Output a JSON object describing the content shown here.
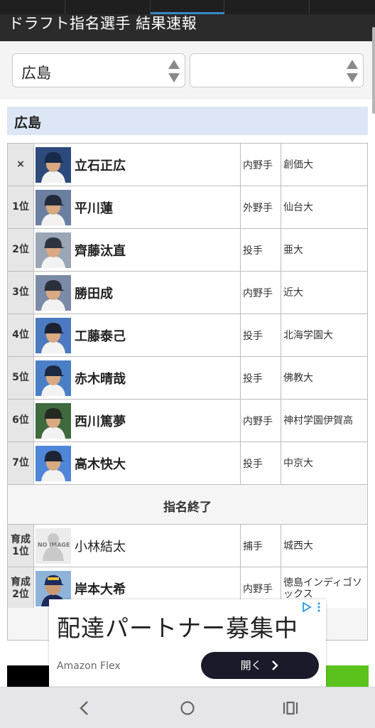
{
  "header": {
    "title": "ドラフト指名選手 結果速報"
  },
  "selects": {
    "team_value": "広島",
    "second_value": ""
  },
  "team_section": {
    "title": "広島"
  },
  "picks": [
    {
      "rank": "×",
      "name": "立石正広",
      "position": "内野手",
      "school": "創価大"
    },
    {
      "rank": "1位",
      "name": "平川蓮",
      "position": "外野手",
      "school": "仙台大"
    },
    {
      "rank": "2位",
      "name": "齊藤汰直",
      "position": "投手",
      "school": "亜大"
    },
    {
      "rank": "3位",
      "name": "勝田成",
      "position": "内野手",
      "school": "近大"
    },
    {
      "rank": "4位",
      "name": "工藤泰己",
      "position": "投手",
      "school": "北海学園大"
    },
    {
      "rank": "5位",
      "name": "赤木晴哉",
      "position": "投手",
      "school": "佛教大"
    },
    {
      "rank": "6位",
      "name": "西川篤夢",
      "position": "内野手",
      "school": "神村学園伊賀高"
    },
    {
      "rank": "7位",
      "name": "高木快大",
      "position": "投手",
      "school": "中京大"
    }
  ],
  "end_label": "指名終了",
  "development": [
    {
      "rank_line1": "育成",
      "rank_line2": "1位",
      "name": "小林結太",
      "position": "捕手",
      "school": "城西大",
      "noimage": "NO IMAGE"
    },
    {
      "rank_line1": "育成",
      "rank_line2": "2位",
      "name": "岸本大希",
      "position": "内野手",
      "school": "徳島インディゴソックス"
    }
  ],
  "ad": {
    "headline": "配達パートナー募集中",
    "brand": "Amazon Flex",
    "button_label": "開く"
  },
  "colors": {
    "topbar": "#2b2b2b",
    "team_header_bg": "#dde6f5",
    "rank_bg": "#e6e6e6",
    "ad_button": "#1a1a2a",
    "tab_indicator": "#3a86c8"
  },
  "icons": {
    "nav": [
      "back-icon",
      "home-icon",
      "recents-icon"
    ],
    "ad": [
      "adchoices-icon",
      "chevron-right-icon"
    ]
  }
}
